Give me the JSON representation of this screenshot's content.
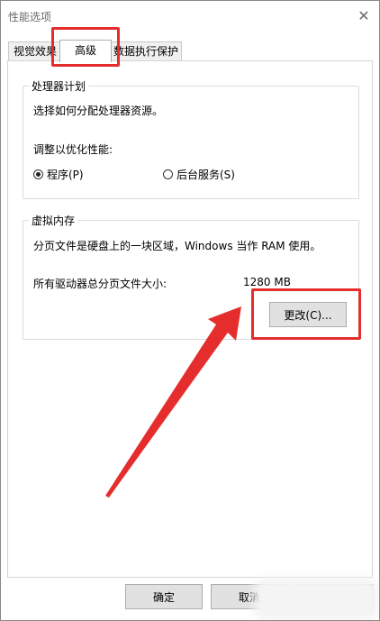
{
  "window": {
    "title": "性能选项",
    "close_glyph": "✕"
  },
  "tabs": [
    {
      "label": "视觉效果",
      "active": false
    },
    {
      "label": "高级",
      "active": true
    },
    {
      "label": "数据执行保护",
      "active": false
    }
  ],
  "processor": {
    "legend": "处理器计划",
    "description": "选择如何分配处理器资源。",
    "optimize_label": "调整以优化性能:",
    "options": [
      {
        "label": "程序(P)",
        "checked": true
      },
      {
        "label": "后台服务(S)",
        "checked": false
      }
    ]
  },
  "virtual_memory": {
    "legend": "虚拟内存",
    "description": "分页文件是硬盘上的一块区域，Windows 当作 RAM 使用。",
    "total_label": "所有驱动器总分页文件大小:",
    "total_value": "1280 MB",
    "change_button": "更改(C)..."
  },
  "footer": {
    "ok_button": "确定",
    "cancel_button": "取消"
  },
  "annotation": {
    "color": "#e52d2d"
  }
}
